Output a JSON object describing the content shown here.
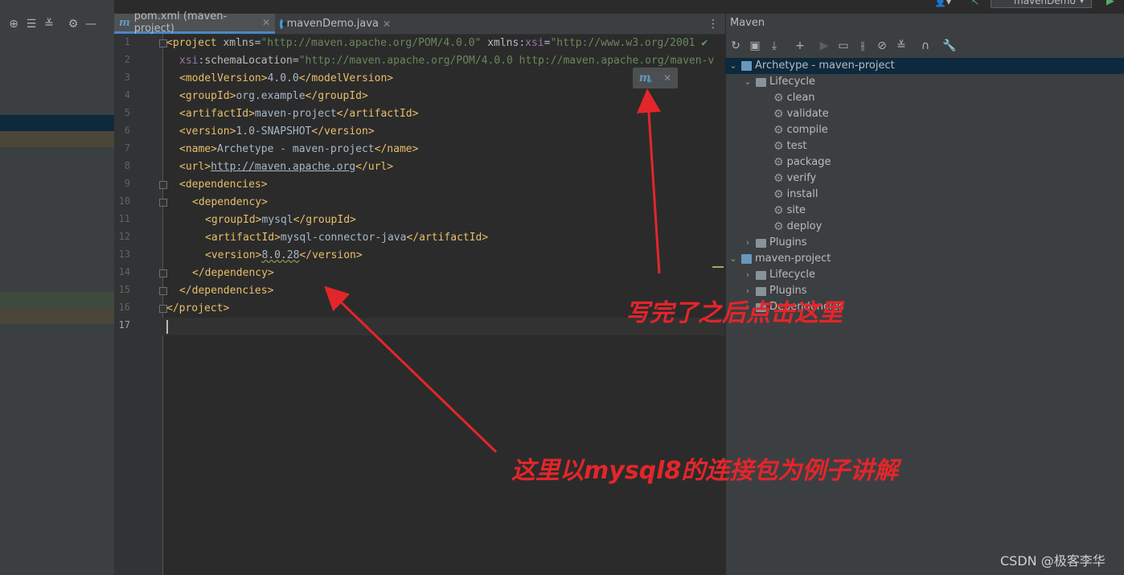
{
  "editor": {
    "tabs": [
      {
        "label": "pom.xml (maven-project)",
        "active": true,
        "icon": "maven-icon"
      },
      {
        "label": "mavenDemo.java",
        "active": false,
        "icon": "java-class-icon"
      }
    ],
    "line_numbers": [
      "1",
      "2",
      "3",
      "4",
      "5",
      "6",
      "7",
      "8",
      "9",
      "10",
      "11",
      "12",
      "13",
      "14",
      "15",
      "16",
      "17"
    ],
    "current_line": "17"
  },
  "maven": {
    "title": "Maven",
    "tree": {
      "project1": "Archetype - maven-project",
      "lifecycle": "Lifecycle",
      "goals": [
        "clean",
        "validate",
        "compile",
        "test",
        "package",
        "verify",
        "install",
        "site",
        "deploy"
      ],
      "plugins": "Plugins",
      "project2": "maven-project",
      "lifecycle2": "Lifecycle",
      "plugins2": "Plugins",
      "dependencies2": "Dependencies"
    }
  },
  "top": {
    "config_name": "mavenDemo"
  },
  "annotations": {
    "click_here": "写完了之后点击这里",
    "example": "这里以mysql8的连接包为例子讲解"
  },
  "watermark": "CSDN @极客李华",
  "colors": {
    "arrow": "#e3262b",
    "accent": "#4a88c7"
  }
}
